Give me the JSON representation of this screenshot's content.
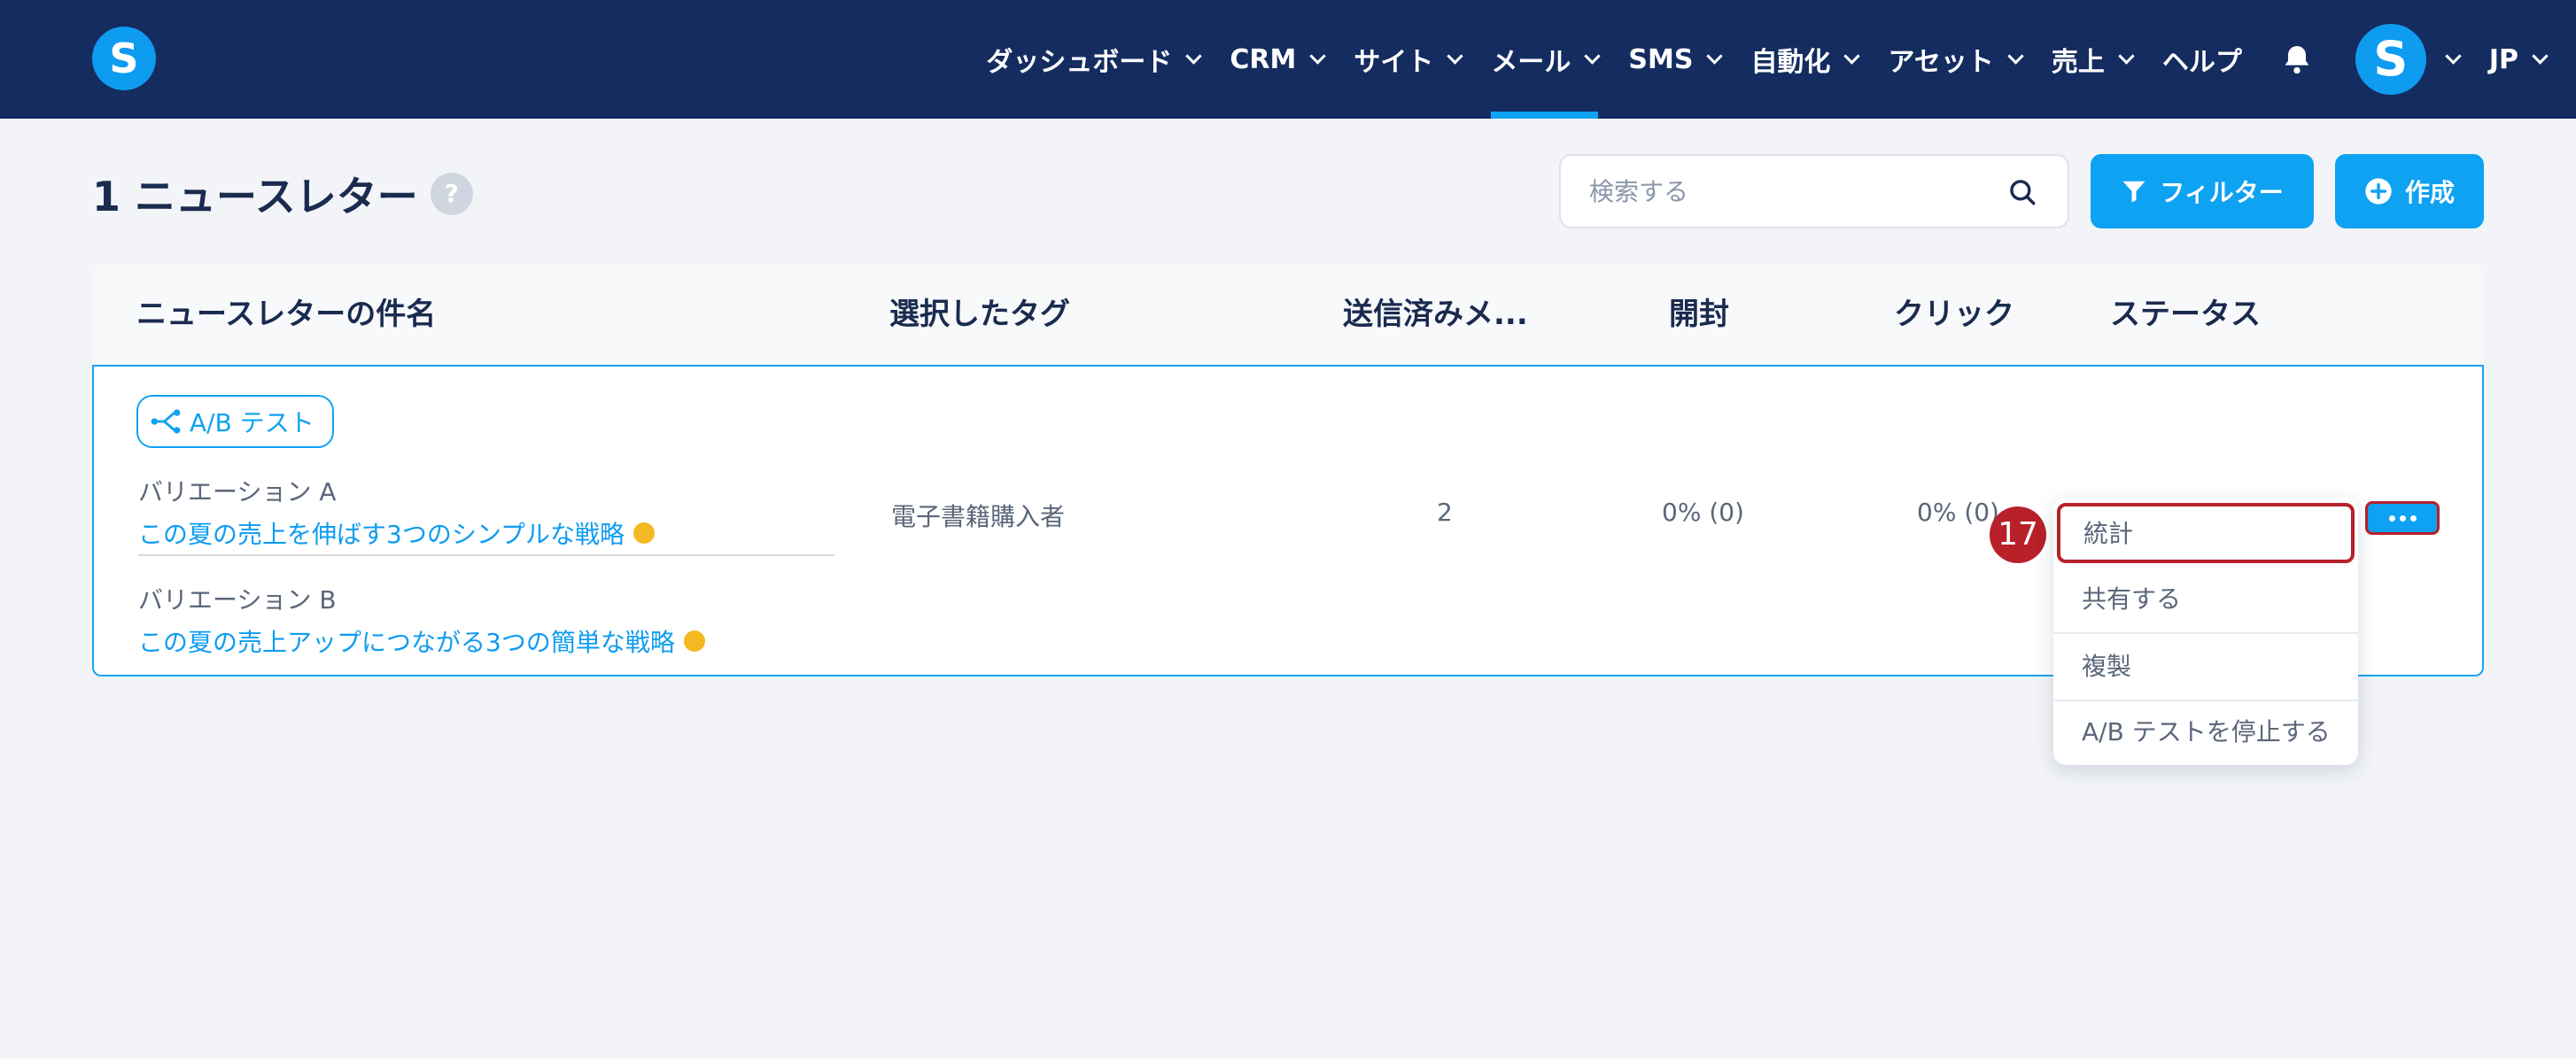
{
  "nav": {
    "logo": "S",
    "items": [
      {
        "label": "ダッシュボード",
        "active": false
      },
      {
        "label": "CRM",
        "active": false
      },
      {
        "label": "サイト",
        "active": false
      },
      {
        "label": "メール",
        "active": true
      },
      {
        "label": "SMS",
        "active": false
      },
      {
        "label": "自動化",
        "active": false
      },
      {
        "label": "アセット",
        "active": false
      },
      {
        "label": "売上",
        "active": false
      },
      {
        "label": "ヘルプ",
        "active": false
      }
    ],
    "avatar": "S",
    "language": "JP"
  },
  "header": {
    "title": "1 ニュースレター",
    "help": "?",
    "search_placeholder": "検索する",
    "filter_label": "フィルター",
    "create_label": "作成"
  },
  "table": {
    "columns": [
      "ニュースレターの件名",
      "選択したタグ",
      "送信済みメ...",
      "開封",
      "クリック",
      "ステータス"
    ],
    "row": {
      "badge": "A/B テスト",
      "variation_a_label": "バリエーション A",
      "variation_a_subject": "この夏の売上を伸ばす3つのシンプルな戦略",
      "variation_b_label": "バリエーション B",
      "variation_b_subject": "この夏の売上アップにつながる3つの簡単な戦略",
      "tag": "電子書籍購入者",
      "sent": "2",
      "opens": "0% (0)",
      "clicks": "0% (0)"
    }
  },
  "menu": {
    "step": "17",
    "items": [
      "統計",
      "共有する",
      "複製",
      "A/B テストを停止する"
    ]
  },
  "colors": {
    "nav_bg": "#142c5f",
    "accent": "#0ea2f2",
    "highlight": "#b8202a"
  }
}
